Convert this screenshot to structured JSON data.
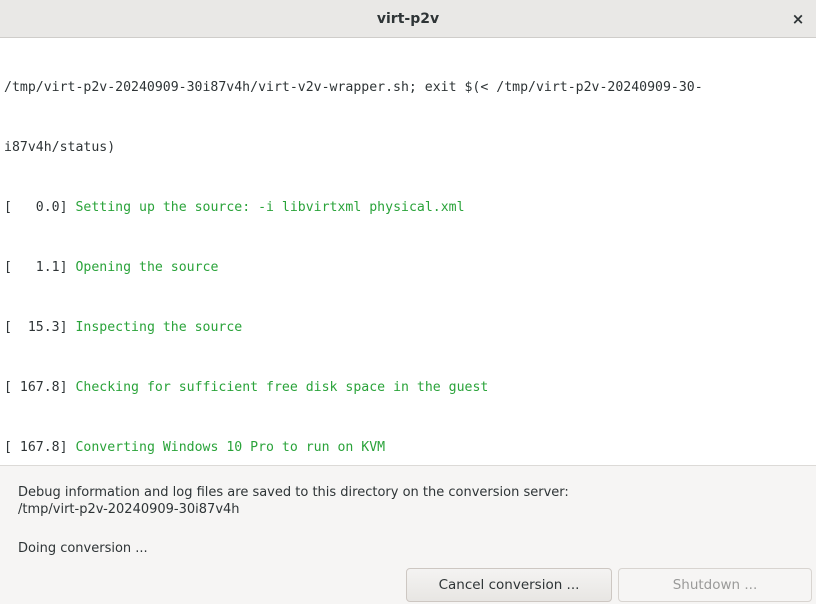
{
  "window": {
    "title": "virt-p2v",
    "close_glyph": "×"
  },
  "terminal": {
    "command_line_1": "/tmp/virt-p2v-20240909-30i87v4h/virt-v2v-wrapper.sh; exit $(< /tmp/virt-p2v-20240909-30-",
    "command_line_2": "i87v4h/status)",
    "log": [
      {
        "time": "[   0.0]",
        "text": "Setting up the source: -i libvirtxml physical.xml"
      },
      {
        "time": "[   1.1]",
        "text": "Opening the source"
      },
      {
        "time": "[  15.3]",
        "text": "Inspecting the source"
      },
      {
        "time": "[ 167.8]",
        "text": "Checking for sufficient free disk space in the guest"
      },
      {
        "time": "[ 167.8]",
        "text": "Converting Windows 10 Pro to run on KVM"
      }
    ]
  },
  "info": {
    "debug_text": "Debug information and log files are saved to this directory on the conversion server:",
    "debug_dir": "/tmp/virt-p2v-20240909-30i87v4h",
    "status": "Doing conversion ..."
  },
  "buttons": {
    "cancel_label": "Cancel conversion ...",
    "shutdown_label": "Shutdown ..."
  },
  "colors": {
    "log_text": "#2aa33a",
    "plain_text": "#2e3436",
    "titlebar": "#e9e8e6"
  }
}
